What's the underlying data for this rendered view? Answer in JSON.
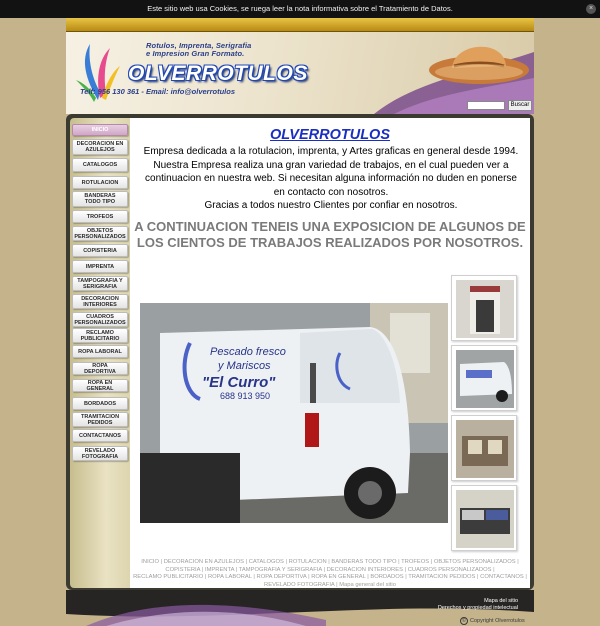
{
  "cookie": {
    "text": "Este sitio web usa Cookies, se ruega leer la nota informativa sobre el Tratamiento de Datos.",
    "close_icon": "×"
  },
  "header": {
    "tagline_1": "Rotulos, Imprenta, Serigrafia",
    "tagline_2": "e Impresion Gran Formato.",
    "logo": "OLVERROTULOS",
    "contact": "Telf: 956 130 361 - Email: info@olverrotulos"
  },
  "search": {
    "placeholder": "",
    "button_label": "Buscar"
  },
  "nav": {
    "items": [
      {
        "label": "INICIO"
      },
      {
        "label": "DECORACION EN AZULEJOS"
      },
      {
        "label": "CATALOGOS"
      },
      {
        "label": "ROTULACION"
      },
      {
        "label": "BANDERAS TODO TIPO"
      },
      {
        "label": "TROFEOS"
      },
      {
        "label": "OBJETOS PERSONALIZADOS"
      },
      {
        "label": "COPISTERIA"
      },
      {
        "label": "IMPRENTA"
      },
      {
        "label": "TAMPOGRAFIA Y SERIGRAFIA"
      },
      {
        "label": "DECORACION INTERIORES"
      },
      {
        "label": "CUADROS PERSONALIZADOS"
      },
      {
        "label": "RECLAMO PUBLICITARIO"
      },
      {
        "label": "ROPA LABORAL"
      },
      {
        "label": "ROPA DEPORTIVA"
      },
      {
        "label": "ROPA EN GENERAL"
      },
      {
        "label": "BORDADOS"
      },
      {
        "label": "TRAMITACION PEDIDOS"
      },
      {
        "label": "CONTACTANOS"
      },
      {
        "label": "REVELADO FOTOGRAFIA"
      }
    ]
  },
  "main": {
    "title": "OLVERROTULOS",
    "intro": "Empresa dedicada a la rotulacion, imprenta, y Artes graficas en general desde 1994. Nuestra Empresa realiza una gran variedad de trabajos, en el cual pueden ver a continuacion en nuestra web. Si necesitan alguna información no duden en ponerse en contacto con nosotros.",
    "thanks": "Gracias a todos nuestro Clientes por confiar en nosotros.",
    "headline": "A CONTINUACION TENEIS UNA EXPOSICION DE ALGUNOS DE LOS CIENTOS DE TRABAJOS REALIZADOS POR NOSOTROS.",
    "van_text_1": "Pescado fresco",
    "van_text_2": "y Mariscos",
    "van_text_3": "\"El Curro\"",
    "van_phone": "688 913 950"
  },
  "footer": {
    "links": [
      "INICIO",
      "DECORACION EN AZULEJOS",
      "CATALOGOS",
      "ROTULACION",
      "BANDERAS TODO TIPO",
      "TROFEOS",
      "OBJETOS PERSONALIZADOS",
      "COPISTERIA",
      "IMPRENTA",
      "TAMPOGRAFIA Y SERIGRAFIA",
      "DECORACION INTERIORES",
      "CUADROS PERSONALIZADOS",
      "RECLAMO PUBLICITARIO",
      "ROPA LABORAL",
      "ROPA DEPORTIVA",
      "ROPA EN GENERAL",
      "BORDADOS",
      "TRAMITACION PEDIDOS",
      "CONTACTANOS",
      "REVELADO FOTOGRAFIA",
      "Mapa general del sitio"
    ],
    "map_link": "Mapa del sitio",
    "rights": "Derechos y propiedad intelectual",
    "copyright": "Copyright Olverrotulos"
  },
  "colors": {
    "background": "#c4b38b",
    "title_blue": "#1a2fc2",
    "headline_gray": "#7a7a7a",
    "active_nav": "#cfa7c6"
  }
}
